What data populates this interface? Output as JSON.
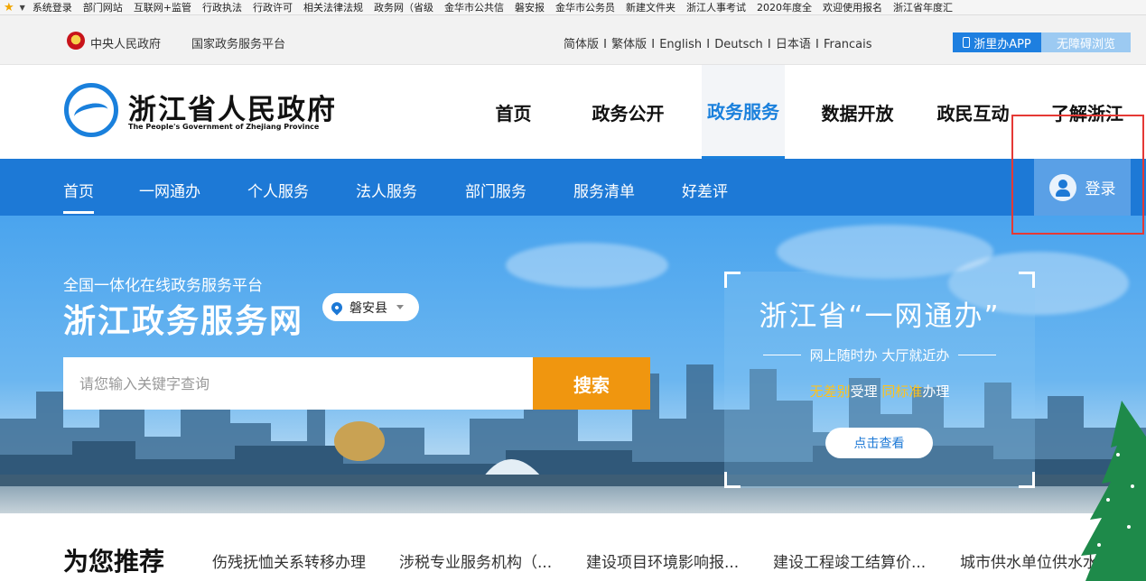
{
  "bookmarks": {
    "items": [
      "系统登录",
      "部门网站",
      "互联网+监管",
      "行政执法",
      "行政许可",
      "相关法律法规",
      "政务网（省级",
      "金华市公共信",
      "磐安报",
      "金华市公务员",
      "新建文件夹",
      "浙江人事考试",
      "2020年度全",
      "欢迎使用报名",
      "浙江省年度汇"
    ]
  },
  "topbar": {
    "central_gov": "中央人民政府",
    "service_platform": "国家政务服务平台",
    "languages": "简体版 I 繁体版 I English I Deutsch I 日本语 I Francais",
    "app_label": "浙里办APP",
    "accessibility_label": "无障碍浏览"
  },
  "header": {
    "title": "浙江省人民政府",
    "subtitle": "The People's Government of Zhejiang Province",
    "nav": [
      "首页",
      "政务公开",
      "政务服务",
      "数据开放",
      "政民互动",
      "了解浙江"
    ],
    "active_nav": "政务服务"
  },
  "subnav": {
    "items": [
      "首页",
      "一网通办",
      "个人服务",
      "法人服务",
      "部门服务",
      "服务清单",
      "好差评"
    ],
    "login_label": "登录"
  },
  "hero": {
    "small_title": "全国一体化在线政务服务平台",
    "big_title": "浙江政务服务网",
    "region": "磐安县",
    "search_placeholder": "请您输入关键字查询",
    "search_button": "搜索",
    "promo": {
      "title": "浙江省“一网通办”",
      "line": "网上随时办 大厅就近办",
      "hl1": "无差别",
      "t1": "受理 ",
      "hl2": "同标准",
      "t2": "办理",
      "button": "点击查看"
    }
  },
  "recommend": {
    "title": "为您推荐",
    "items": [
      "伤残抚恤关系转移办理",
      "涉税专业服务机构（...",
      "建设项目环境影响报...",
      "建设工程竣工结算价...",
      "城市供水单位供水水质"
    ]
  },
  "colors": {
    "primary_blue": "#1d79d6",
    "orange": "#f0960f",
    "highlight_yellow": "#ffc21a",
    "annotation_red": "#e53935"
  }
}
